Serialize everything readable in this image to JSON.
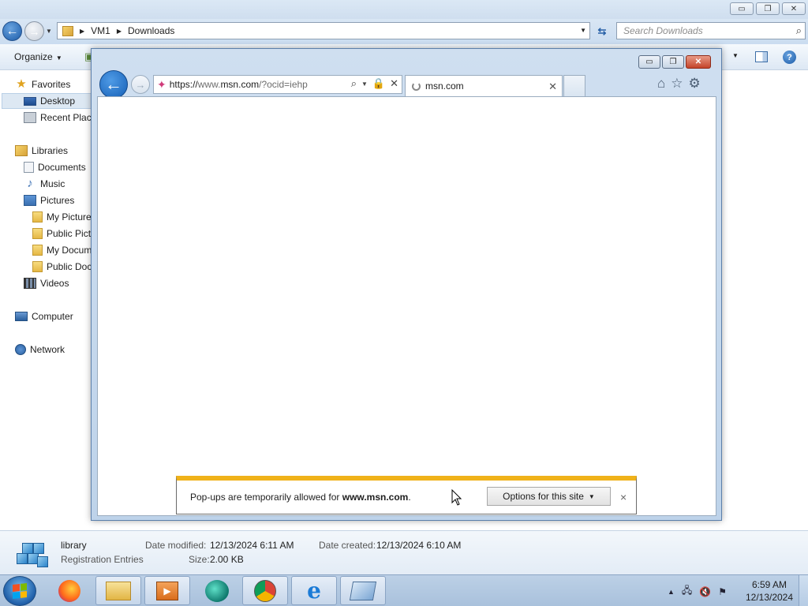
{
  "explorer": {
    "caption_buttons": {
      "minimize": "▭",
      "maximize": "❐",
      "close": "✕"
    },
    "breadcrumb": [
      "VM1",
      "Downloads"
    ],
    "search_placeholder": "Search Downloads",
    "organize_label": "Organize",
    "nav": {
      "favorites": "Favorites",
      "desktop": "Desktop",
      "recent_places": "Recent Places",
      "libraries": "Libraries",
      "documents": "Documents",
      "music": "Music",
      "pictures": "Pictures",
      "my_pictures": "My Pictures",
      "public_pictures": "Public Pictures",
      "my_documents": "My Documents",
      "public_documents": "Public Documents",
      "videos": "Videos",
      "computer": "Computer",
      "network": "Network"
    },
    "details": {
      "name": "library",
      "type": "Registration Entries",
      "date_modified_label": "Date modified:",
      "date_modified": "12/13/2024 6:11 AM",
      "date_created_label": "Date created:",
      "date_created": "12/13/2024 6:10 AM",
      "size_label": "Size:",
      "size": "2.00 KB"
    }
  },
  "ie": {
    "url_scheme": "https://",
    "url_www": "www.",
    "url_domain": "msn.com",
    "url_rest": "/?ocid=iehp",
    "tab_title": "msn.com",
    "popup": {
      "text_prefix": "Pop-ups are temporarily allowed for ",
      "site": "www.msn.com",
      "text_suffix": ".",
      "options_label": "Options for this site",
      "close": "×"
    }
  },
  "taskbar": {
    "time": "6:59 AM",
    "date": "12/13/2024",
    "ie_glyph": "e"
  },
  "icons": [
    "back-arrow-icon",
    "forward-arrow-icon",
    "refresh-icon",
    "search-icon",
    "lock-icon",
    "home-icon",
    "favorites-star-icon",
    "gear-icon"
  ],
  "colors": {
    "popup_accent": "#f0b21a",
    "ie_back": "#155fb6",
    "taskbar": "#bcd0e6"
  }
}
